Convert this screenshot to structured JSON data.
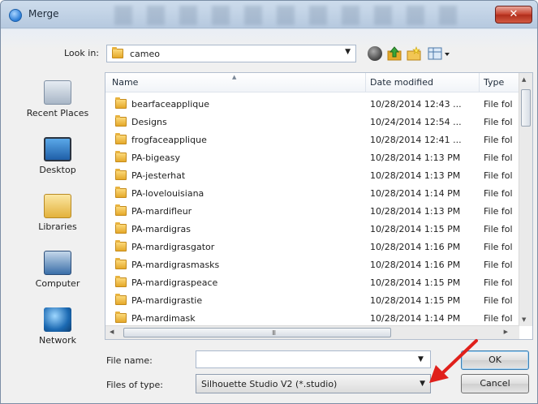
{
  "window": {
    "title": "Merge",
    "close_glyph": "✕"
  },
  "lookin": {
    "label": "Look in:",
    "value": "cameo",
    "icon": "folder-icon"
  },
  "toolbar": {
    "icons": [
      "back-icon",
      "up-folder-icon",
      "new-folder-icon",
      "view-menu-icon"
    ]
  },
  "places": [
    {
      "label": "Recent Places",
      "icon": "recent-places-icon"
    },
    {
      "label": "Desktop",
      "icon": "desktop-icon"
    },
    {
      "label": "Libraries",
      "icon": "libraries-icon"
    },
    {
      "label": "Computer",
      "icon": "computer-icon"
    },
    {
      "label": "Network",
      "icon": "network-icon"
    }
  ],
  "columns": {
    "name": "Name",
    "date": "Date modified",
    "type": "Type"
  },
  "files": [
    {
      "name": "bearfaceapplique",
      "date": "10/28/2014 12:43 ...",
      "type": "File fol"
    },
    {
      "name": "Designs",
      "date": "10/24/2014 12:54 ...",
      "type": "File fol"
    },
    {
      "name": "frogfaceapplique",
      "date": "10/28/2014 12:41 ...",
      "type": "File fol"
    },
    {
      "name": "PA-bigeasy",
      "date": "10/28/2014 1:13 PM",
      "type": "File fol"
    },
    {
      "name": "PA-jesterhat",
      "date": "10/28/2014 1:13 PM",
      "type": "File fol"
    },
    {
      "name": "PA-lovelouisiana",
      "date": "10/28/2014 1:14 PM",
      "type": "File fol"
    },
    {
      "name": "PA-mardifleur",
      "date": "10/28/2014 1:13 PM",
      "type": "File fol"
    },
    {
      "name": "PA-mardigras",
      "date": "10/28/2014 1:15 PM",
      "type": "File fol"
    },
    {
      "name": "PA-mardigrasgator",
      "date": "10/28/2014 1:16 PM",
      "type": "File fol"
    },
    {
      "name": "PA-mardigrasmasks",
      "date": "10/28/2014 1:16 PM",
      "type": "File fol"
    },
    {
      "name": "PA-mardigraspeace",
      "date": "10/28/2014 1:15 PM",
      "type": "File fol"
    },
    {
      "name": "PA-mardigrastie",
      "date": "10/28/2014 1:15 PM",
      "type": "File fol"
    },
    {
      "name": "PA-mardimask",
      "date": "10/28/2014 1:14 PM",
      "type": "File fol"
    }
  ],
  "hscroll": {
    "grip": "III"
  },
  "filename": {
    "label": "File name:",
    "value": ""
  },
  "filetype": {
    "label": "Files of type:",
    "value": "Silhouette Studio V2 (*.studio)"
  },
  "buttons": {
    "ok": "OK",
    "cancel": "Cancel"
  },
  "colors": {
    "accent": "#2a7cd6",
    "close": "#c7432f",
    "annotation_arrow": "#e0201b",
    "folder": "#e5a92a"
  }
}
